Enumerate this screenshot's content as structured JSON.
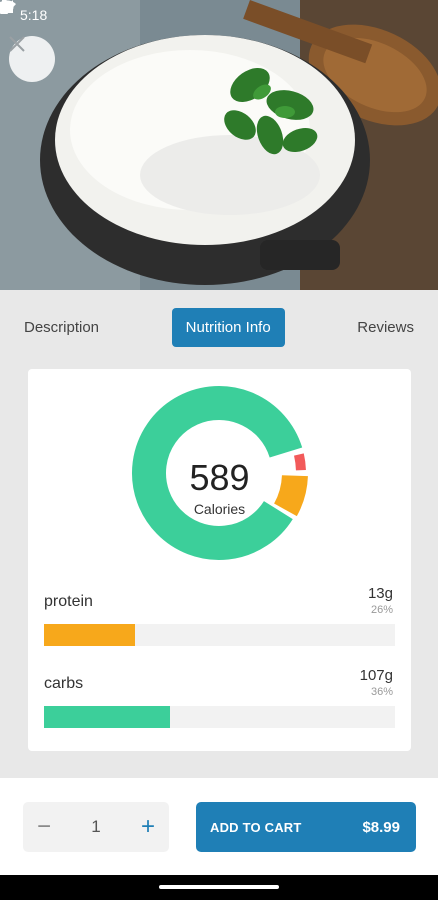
{
  "status_bar": {
    "time": "5:18"
  },
  "tabs": [
    {
      "label": "Description",
      "active": false
    },
    {
      "label": "Nutrition Info",
      "active": true
    },
    {
      "label": "Reviews",
      "active": false
    }
  ],
  "nutrition": {
    "calories": "589",
    "calories_label": "Calories",
    "nutrients": [
      {
        "name": "protein",
        "amount": "13g",
        "percent": "26%",
        "value": 26,
        "color": "#f7a81b"
      },
      {
        "name": "carbs",
        "amount": "107g",
        "percent": "36%",
        "value": 36,
        "color": "#3ccf9a"
      }
    ],
    "donut_segments": [
      {
        "name": "carbs",
        "color": "#3ccf9a"
      },
      {
        "name": "fat",
        "color": "#f25a5a"
      },
      {
        "name": "protein",
        "color": "#f7a81b"
      }
    ]
  },
  "cart": {
    "quantity": "1",
    "minus_symbol": "−",
    "plus_symbol": "+",
    "add_label": "ADD TO CART",
    "price": "$8.99"
  },
  "colors": {
    "accent": "#1f7fb6",
    "carbs": "#3ccf9a",
    "protein": "#f7a81b",
    "fat": "#f25a5a"
  },
  "icons": [
    "settings-icon",
    "shield-icon",
    "wifi-icon",
    "signal-icon",
    "battery-icon",
    "close-icon"
  ]
}
